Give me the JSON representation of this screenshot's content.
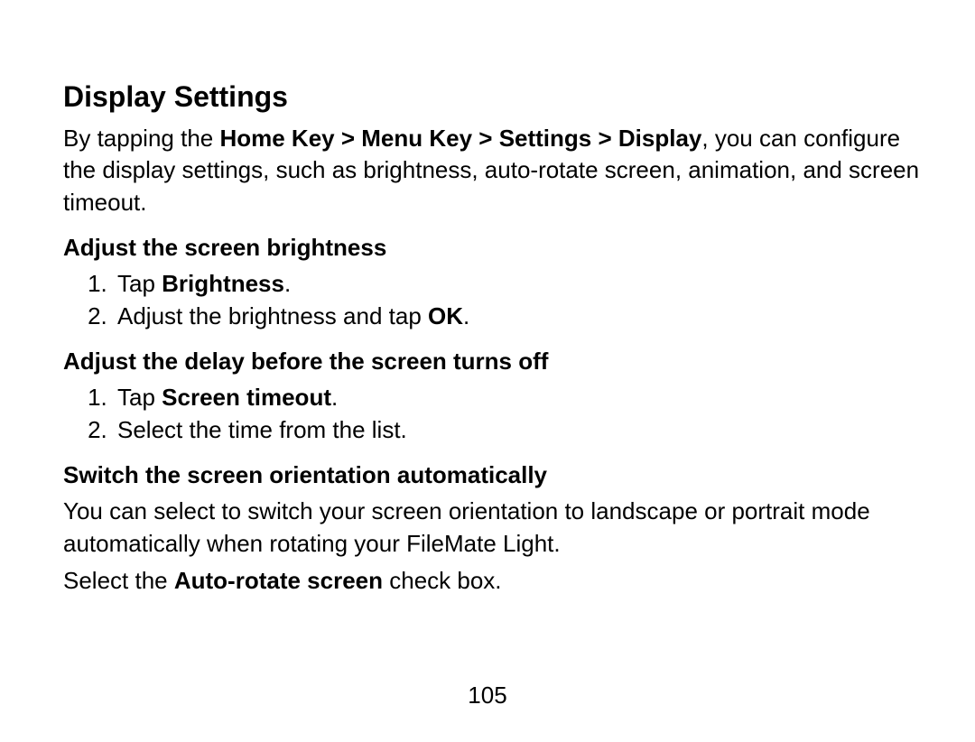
{
  "title": "Display Settings",
  "intro": {
    "pre": "By tapping the ",
    "bold": "Home Key > Menu Key > Settings > Display",
    "post": ", you can configure the display settings, such as brightness, auto-rotate screen, animation, and screen timeout."
  },
  "section1": {
    "heading": "Adjust the screen brightness",
    "step1_pre": "Tap ",
    "step1_bold": "Brightness",
    "step1_post": ".",
    "step2_pre": "Adjust the brightness and tap ",
    "step2_bold": "OK",
    "step2_post": "."
  },
  "section2": {
    "heading": "Adjust the delay before the screen turns off",
    "step1_pre": "Tap ",
    "step1_bold": "Screen timeout",
    "step1_post": ".",
    "step2": "Select the time from the list."
  },
  "section3": {
    "heading": "Switch the screen orientation automatically",
    "para": "You can select to switch your screen orientation to landscape or portrait mode automatically when rotating your FileMate Light.",
    "line2_pre": "Select the ",
    "line2_bold": "Auto-rotate screen",
    "line2_post": " check box."
  },
  "page_number": "105"
}
